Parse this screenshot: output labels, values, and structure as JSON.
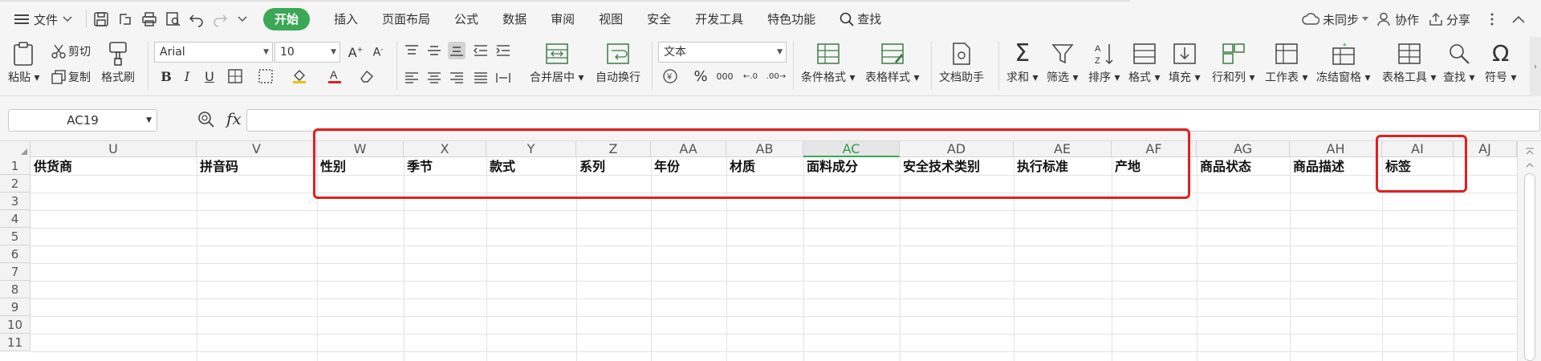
{
  "menu": {
    "file_label": "文件",
    "tabs": [
      {
        "label": "开始",
        "active": true
      },
      {
        "label": "插入"
      },
      {
        "label": "页面布局"
      },
      {
        "label": "公式"
      },
      {
        "label": "数据"
      },
      {
        "label": "审阅"
      },
      {
        "label": "视图"
      },
      {
        "label": "安全"
      },
      {
        "label": "开发工具"
      },
      {
        "label": "特色功能"
      }
    ],
    "search_label": "查找",
    "sync_label": "未同步",
    "collab_label": "协作",
    "share_label": "分享"
  },
  "ribbon": {
    "paste": "粘贴",
    "cut": "剪切",
    "copy": "复制",
    "format_painter": "格式刷",
    "font_name": "Arial",
    "font_size": "10",
    "merge_center": "合并居中",
    "wrap_text": "自动换行",
    "number_format": "文本",
    "percent": "%",
    "thousands": "000",
    "cond_format": "条件格式",
    "table_style": "表格样式",
    "doc_assistant": "文档助手",
    "sum": "求和",
    "filter": "筛选",
    "sort": "排序",
    "format": "格式",
    "fill": "填充",
    "rows_cols": "行和列",
    "worksheet": "工作表",
    "freeze": "冻结窗格",
    "table_tools": "表格工具",
    "find": "查找",
    "symbol": "符号"
  },
  "formula_bar": {
    "name_box": "AC19",
    "fx": "fx",
    "formula": ""
  },
  "grid": {
    "columns": [
      "U",
      "V",
      "W",
      "X",
      "Y",
      "Z",
      "AA",
      "AB",
      "AC",
      "AD",
      "AE",
      "AF",
      "AG",
      "AH",
      "AI",
      "AJ"
    ],
    "active_column": "AC",
    "rows": [
      "1",
      "2",
      "3",
      "4",
      "5",
      "6",
      "7",
      "8",
      "9",
      "10",
      "11"
    ],
    "row1": [
      "供货商",
      "拼音码",
      "性别",
      "季节",
      "款式",
      "系列",
      "年份",
      "材质",
      "面料成分",
      "安全技术类别",
      "执行标准",
      "产地",
      "商品状态",
      "商品描述",
      "标签",
      ""
    ]
  },
  "colors": {
    "accent": "#3aa855",
    "highlight": "#e02020"
  }
}
